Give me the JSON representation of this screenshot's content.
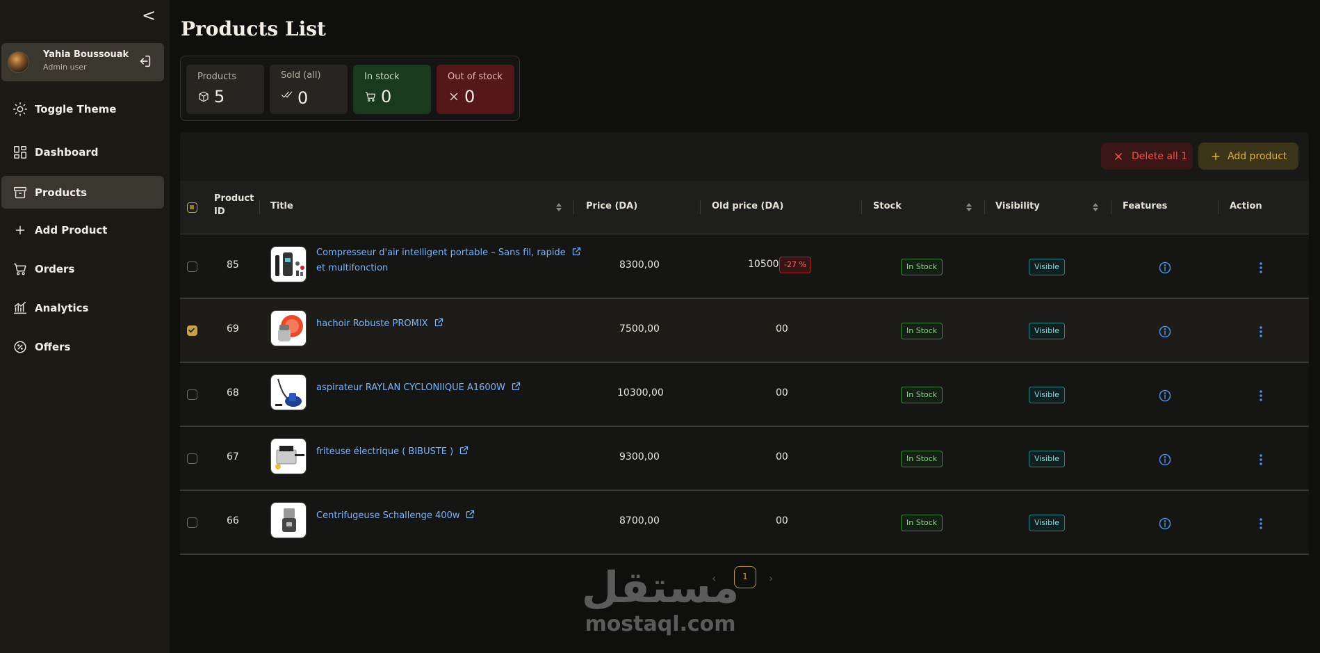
{
  "sidebar": {
    "collapse_label": "<",
    "user": {
      "name": "Yahia Boussouak",
      "role": "Admin user"
    },
    "items": [
      {
        "label": "Toggle Theme",
        "icon": "sun-icon"
      },
      {
        "label": "Dashboard",
        "icon": "dashboard-icon"
      },
      {
        "label": "Products",
        "icon": "archive-icon",
        "active": true
      },
      {
        "label": "Add Product",
        "icon": "plus-icon"
      },
      {
        "label": "Orders",
        "icon": "cart-icon"
      },
      {
        "label": "Analytics",
        "icon": "analytics-icon"
      },
      {
        "label": "Offers",
        "icon": "offer-icon"
      }
    ]
  },
  "page": {
    "title": "Products List"
  },
  "stats": [
    {
      "label": "Products",
      "value": "5",
      "icon": "box-icon"
    },
    {
      "label": "Sold (all)",
      "value": "0",
      "icon": "double-check-icon"
    },
    {
      "label": "In stock",
      "value": "0",
      "icon": "cart-icon"
    },
    {
      "label": "Out of stock",
      "value": "0",
      "icon": "x-icon"
    }
  ],
  "toolbar": {
    "delete_label": "Delete all 1",
    "add_label": "Add product"
  },
  "table": {
    "headers": {
      "id_line1": "Product",
      "id_line2": "ID",
      "title": "Title",
      "price": "Price (DA)",
      "old_price": "Old price (DA)",
      "stock": "Stock",
      "visibility": "Visibility",
      "features": "Features",
      "action": "Action"
    },
    "rows": [
      {
        "id": "85",
        "title_line1": "Compresseur d'air intelligent portable – Sans fil, rapide",
        "title_line2": "et multifonction",
        "price": "8300,00",
        "old_price": "10500",
        "discount": "-27 %",
        "stock": "In Stock",
        "visibility": "Visible",
        "selected": false
      },
      {
        "id": "69",
        "title_line1": "hachoir Robuste PROMIX",
        "title_line2": "",
        "price": "7500,00",
        "old_price": "00",
        "discount": "",
        "stock": "In Stock",
        "visibility": "Visible",
        "selected": true
      },
      {
        "id": "68",
        "title_line1": "aspirateur RAYLAN CYCLONIIQUE A1600W",
        "title_line2": "",
        "price": "10300,00",
        "old_price": "00",
        "discount": "",
        "stock": "In Stock",
        "visibility": "Visible",
        "selected": false
      },
      {
        "id": "67",
        "title_line1": "friteuse électrique ( BIBUSTE )",
        "title_line2": "",
        "price": "9300,00",
        "old_price": "00",
        "discount": "",
        "stock": "In Stock",
        "visibility": "Visible",
        "selected": false
      },
      {
        "id": "66",
        "title_line1": "Centrifugeuse Schallenge 400w",
        "title_line2": "",
        "price": "8700,00",
        "old_price": "00",
        "discount": "",
        "stock": "In Stock",
        "visibility": "Visible",
        "selected": false
      }
    ]
  },
  "pagination": {
    "prev": "‹",
    "current": "1",
    "next": "›"
  },
  "watermark": {
    "arabic": "مستقل",
    "latin": "mostaql.com"
  },
  "colors": {
    "accent": "#c8a045",
    "link": "#7db3f5",
    "danger": "#ef5350",
    "success": "#8fd48f"
  }
}
